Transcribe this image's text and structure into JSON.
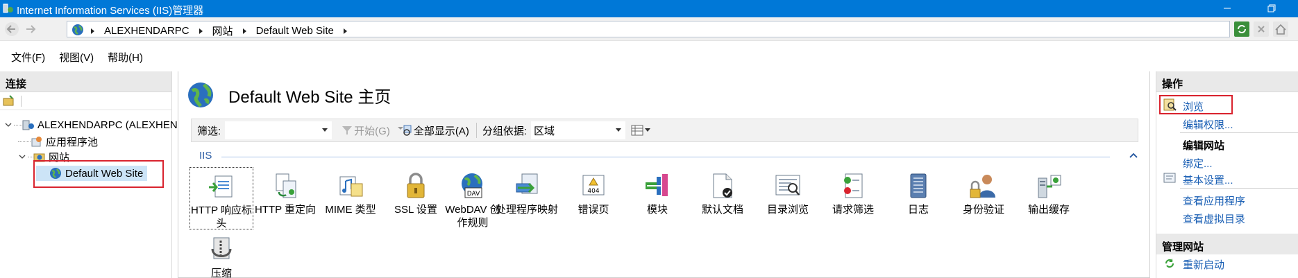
{
  "window": {
    "title": "Internet Information Services (IIS)管理器"
  },
  "address": {
    "crumbs": [
      "ALEXHENDARPC",
      "网站",
      "Default Web Site"
    ]
  },
  "menu": [
    "文件(F)",
    "视图(V)",
    "帮助(H)"
  ],
  "connections": {
    "header": "连接",
    "tree": {
      "server": "ALEXHENDARPC (ALEXHEN",
      "app_pools": "应用程序池",
      "sites": "网站",
      "default_site": "Default Web Site"
    }
  },
  "center": {
    "page_title": "Default Web Site 主页",
    "filter": {
      "label": "筛选:",
      "value": "",
      "go": "开始(G)",
      "show_all": "全部显示(A)",
      "group_by_label": "分组依据:",
      "group_by_value": "区域"
    },
    "group_name": "IIS",
    "features": [
      {
        "label": "HTTP 响应标头",
        "icon": "http-response-headers-icon"
      },
      {
        "label": "HTTP 重定向",
        "icon": "http-redirect-icon"
      },
      {
        "label": "MIME 类型",
        "icon": "mime-types-icon"
      },
      {
        "label": "SSL 设置",
        "icon": "ssl-lock-icon"
      },
      {
        "label": "WebDAV 创作规则",
        "icon": "webdav-globe-icon"
      },
      {
        "label": "处理程序映射",
        "icon": "handler-mappings-icon"
      },
      {
        "label": "错误页",
        "icon": "error-pages-404-icon"
      },
      {
        "label": "模块",
        "icon": "modules-icon"
      },
      {
        "label": "默认文档",
        "icon": "default-document-icon"
      },
      {
        "label": "目录浏览",
        "icon": "directory-browsing-icon"
      },
      {
        "label": "请求筛选",
        "icon": "request-filtering-icon"
      },
      {
        "label": "日志",
        "icon": "logging-icon"
      },
      {
        "label": "身份验证",
        "icon": "authentication-icon"
      },
      {
        "label": "输出缓存",
        "icon": "output-caching-icon"
      },
      {
        "label": "压缩",
        "icon": "compression-icon"
      }
    ]
  },
  "actions": {
    "header": "操作",
    "browse": "浏览",
    "edit_permissions": "编辑权限...",
    "edit_site_header": "编辑网站",
    "bindings": "绑定...",
    "basic_settings": "基本设置...",
    "view_applications": "查看应用程序",
    "view_virtual_dirs": "查看虚拟目录",
    "manage_site_header": "管理网站",
    "restart": "重新启动"
  },
  "colors": {
    "titlebar": "#0078d7",
    "link": "#1a5fb4",
    "highlight": "#d9232e"
  }
}
